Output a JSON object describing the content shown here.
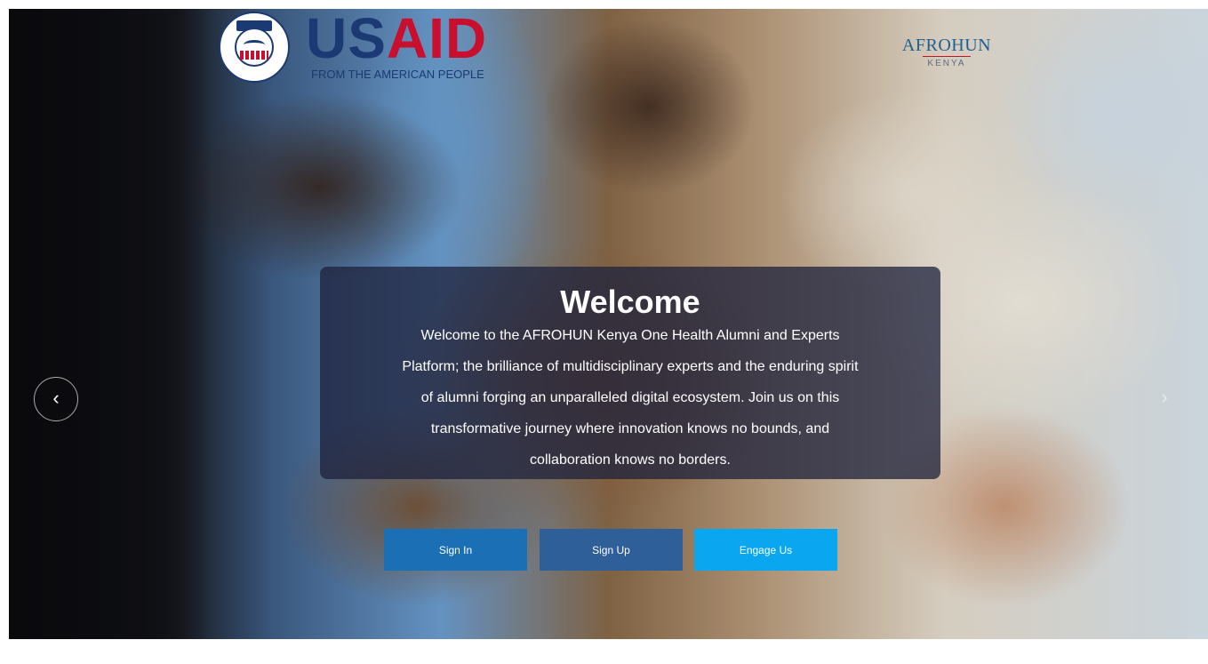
{
  "logos": {
    "usaid": {
      "seal_tag": "USAID",
      "word_us": "US",
      "word_aid": "AID",
      "tagline": "FROM THE AMERICAN PEOPLE"
    },
    "afrohun": {
      "name": "AFROHUN",
      "country": "KENYA"
    }
  },
  "hero": {
    "title": "Welcome",
    "lines": [
      "Welcome to the AFROHUN Kenya One Health Alumni and Experts",
      "Platform; the brilliance of multidisciplinary experts and the enduring spirit",
      "of alumni forging an unparalleled digital ecosystem. Join us on this",
      "transformative journey where innovation knows no bounds, and",
      "collaboration knows no borders."
    ]
  },
  "carousel": {
    "prev_icon": "chevron-left-icon",
    "next_icon": "chevron-right-icon",
    "prev_glyph": "‹",
    "next_glyph": "›"
  },
  "actions": {
    "sign_in": "Sign In",
    "sign_up": "Sign Up",
    "engage_us": "Engage Us"
  },
  "colors": {
    "sign_in_bg": "#1a6fb5",
    "sign_up_bg": "#2f5f98",
    "engage_bg": "#0aa6ef",
    "usaid_blue": "#1b3a73",
    "usaid_red": "#c8102e"
  }
}
